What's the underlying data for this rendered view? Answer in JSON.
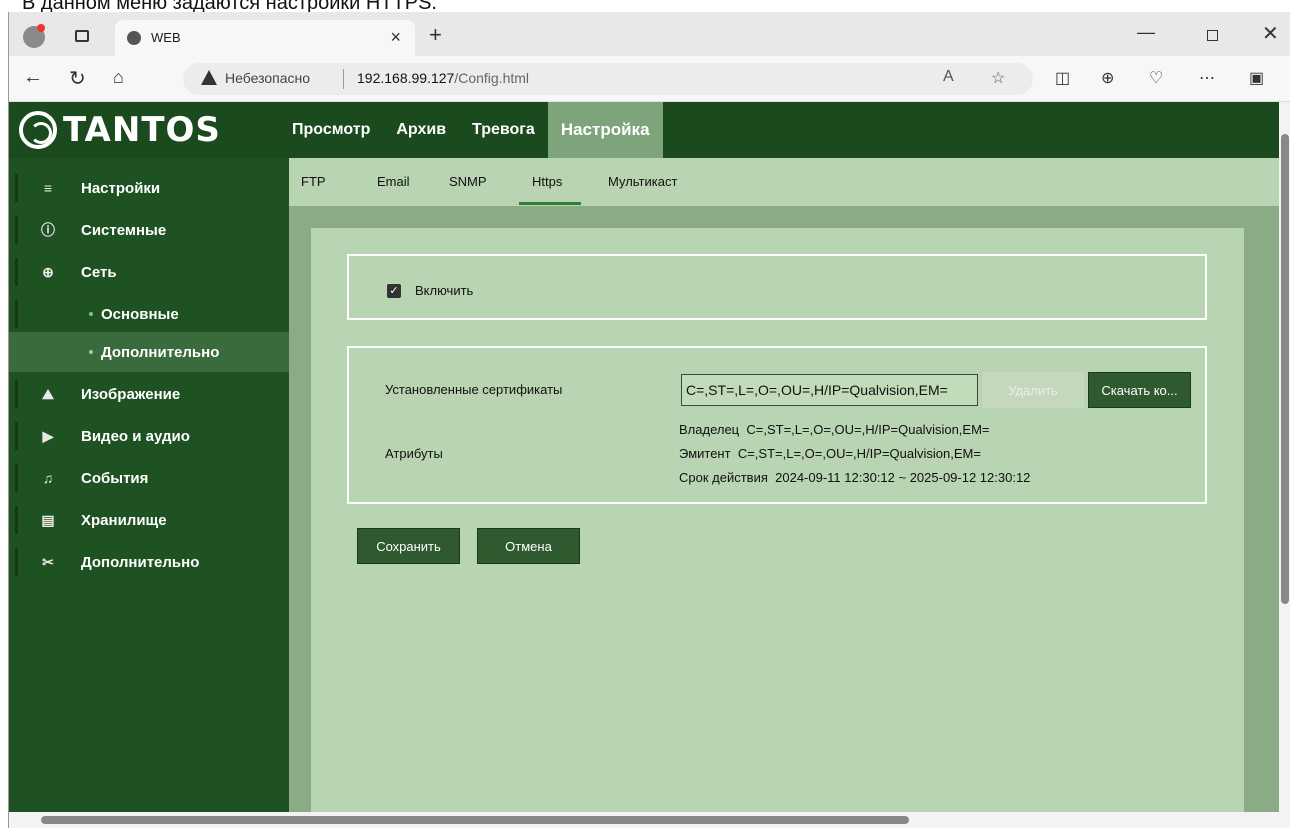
{
  "caption": "В данном меню задаются настройки HTTPS.",
  "browser": {
    "tab_title": "WEB",
    "insecure_label": "Небезопасно",
    "url_host": "192.168.99.127",
    "url_path": "/Config.html"
  },
  "brand": "TANTOS",
  "main_nav": [
    "Просмотр",
    "Архив",
    "Тревога",
    "Настройка"
  ],
  "sidebar": {
    "items": [
      {
        "label": "Настройки",
        "icon": "menu-icon"
      },
      {
        "label": "Системные",
        "icon": "info-icon"
      },
      {
        "label": "Сеть",
        "icon": "globe-icon"
      },
      {
        "label": "Основные",
        "icon": "dot"
      },
      {
        "label": "Дополнительно",
        "icon": "dot"
      },
      {
        "label": "Изображение",
        "icon": "image-icon"
      },
      {
        "label": "Видео и аудио",
        "icon": "video-icon"
      },
      {
        "label": "События",
        "icon": "bell-icon"
      },
      {
        "label": "Хранилище",
        "icon": "storage-icon"
      },
      {
        "label": "Дополнительно",
        "icon": "tools-icon"
      }
    ]
  },
  "sub_nav": [
    "FTP",
    "Email",
    "SNMP",
    "Https",
    "Мультикаст"
  ],
  "form": {
    "enable_label": "Включить",
    "enabled": true,
    "installed_certs_label": "Установленные сертификаты",
    "installed_cert_value": "C=,ST=,L=,O=,OU=,H/IP=Qualvision,EM=",
    "delete_label": "Удалить",
    "download_label": "Скачать ко...",
    "attributes_label": "Атрибуты",
    "owner_label": "Владелец",
    "owner_value": "C=,ST=,L=,O=,OU=,H/IP=Qualvision,EM=",
    "issuer_label": "Эмитент",
    "issuer_value": "C=,ST=,L=,O=,OU=,H/IP=Qualvision,EM=",
    "validity_label": "Срок действия",
    "validity_value": "2024-09-11 12:30:12 ~ 2025-09-12 12:30:12",
    "save_label": "Сохранить",
    "cancel_label": "Отмена"
  }
}
